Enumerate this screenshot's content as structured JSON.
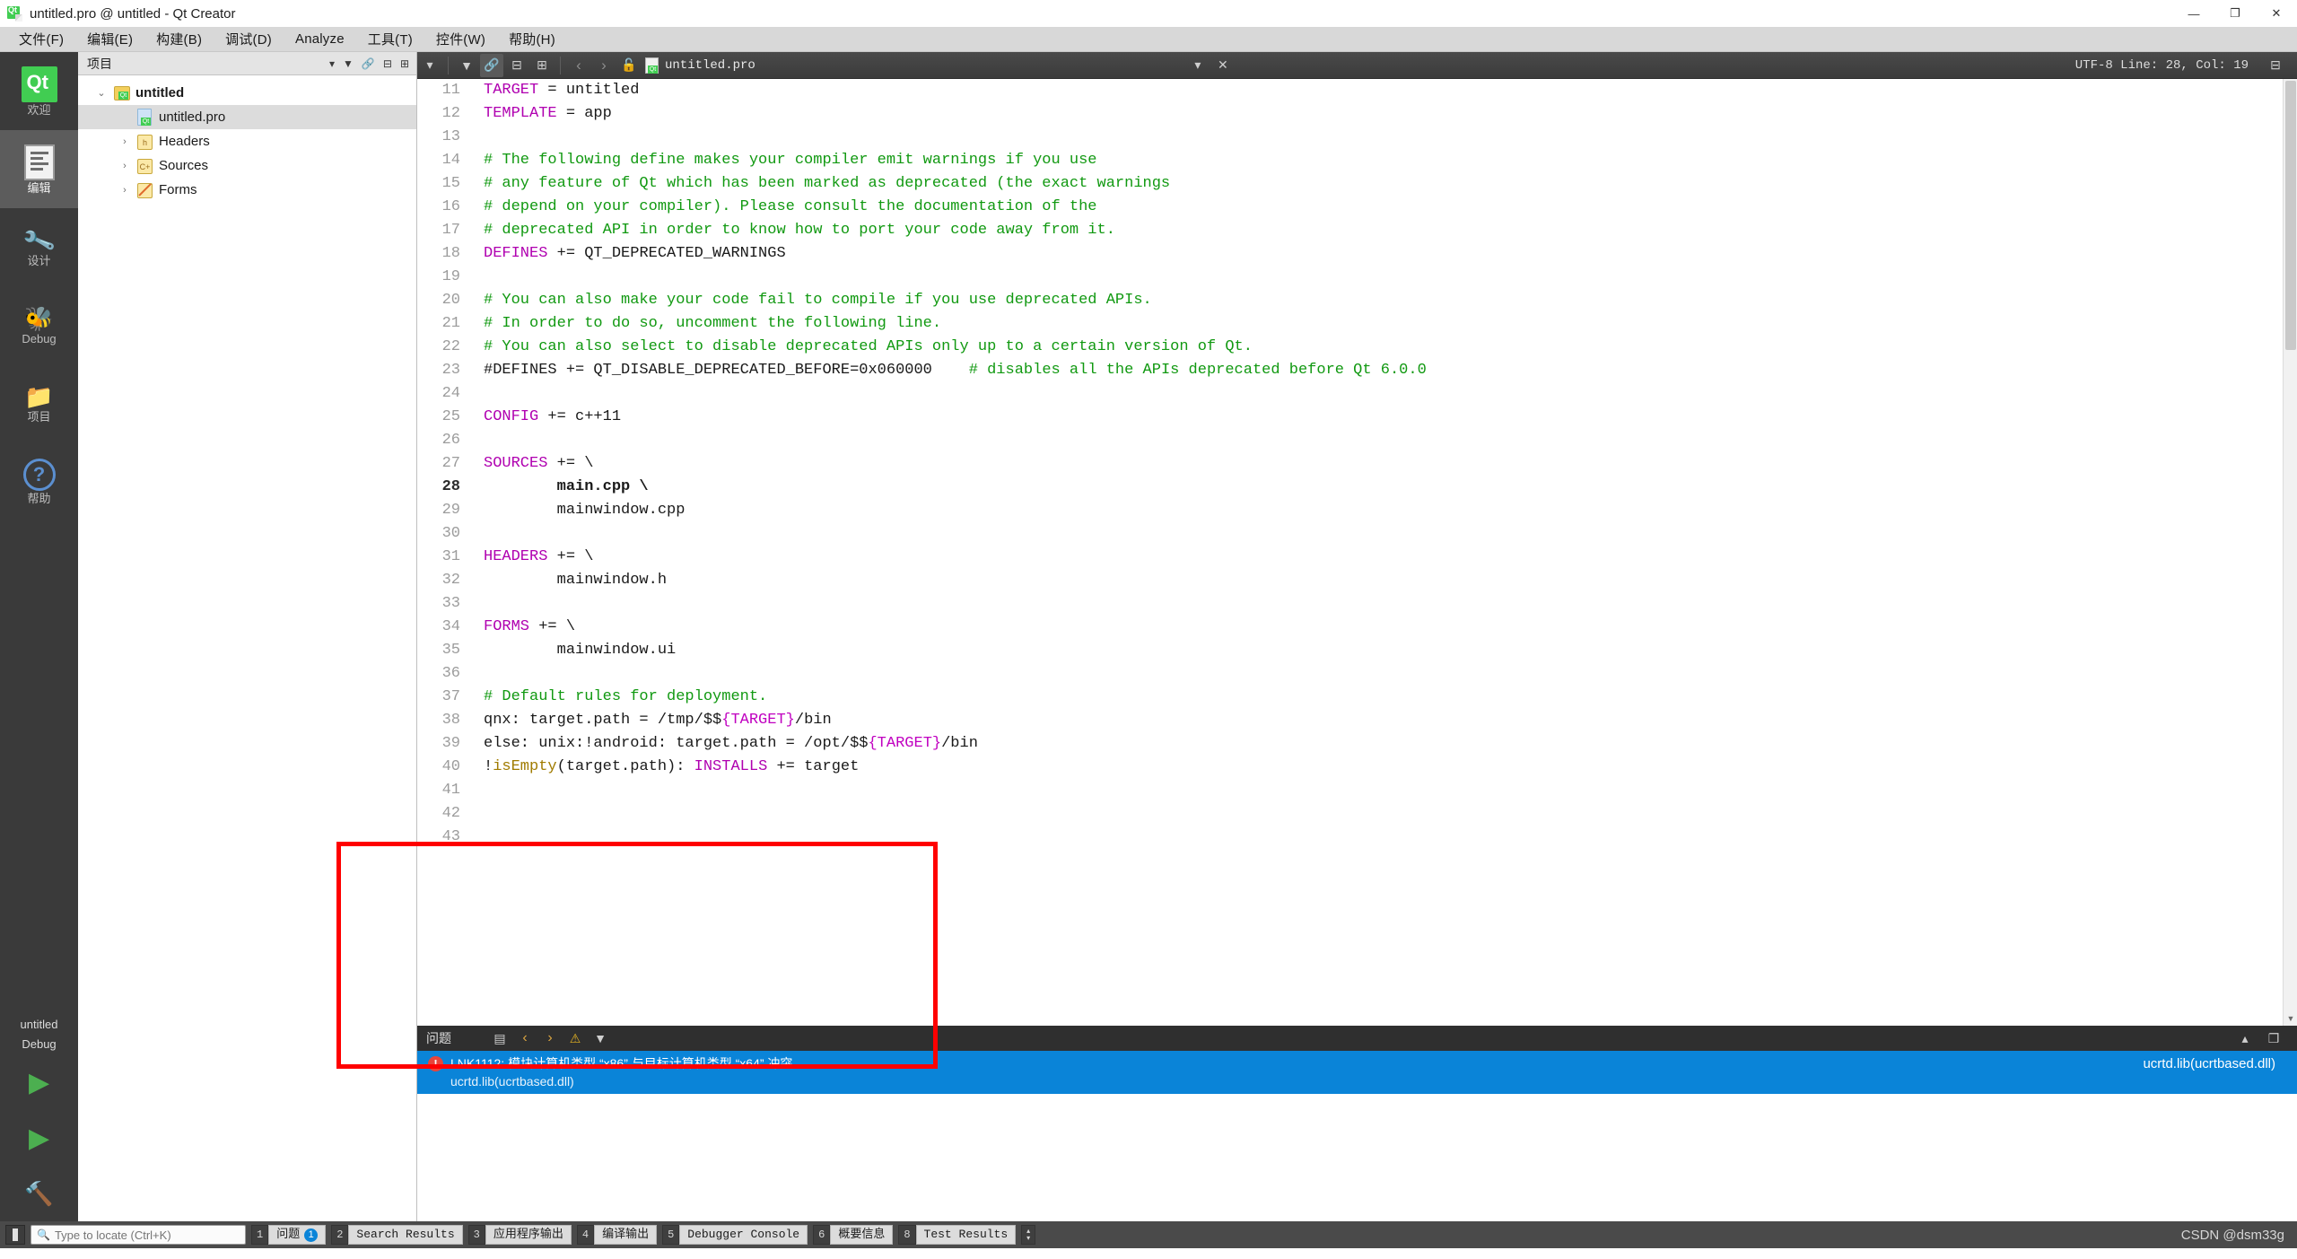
{
  "window": {
    "title": "untitled.pro @ untitled - Qt Creator",
    "minimize": "—",
    "maximize": "❐",
    "close": "✕"
  },
  "menubar": [
    {
      "label": "文件(F)"
    },
    {
      "label": "编辑(E)"
    },
    {
      "label": "构建(B)"
    },
    {
      "label": "调试(D)"
    },
    {
      "label": "Analyze"
    },
    {
      "label": "工具(T)"
    },
    {
      "label": "控件(W)"
    },
    {
      "label": "帮助(H)"
    }
  ],
  "modebar": {
    "items": [
      {
        "label": "欢迎",
        "icon": "qt-logo-icon",
        "selected": false
      },
      {
        "label": "编辑",
        "icon": "document-icon",
        "selected": true
      },
      {
        "label": "设计",
        "icon": "design-wrench-icon",
        "selected": false
      },
      {
        "label": "Debug",
        "icon": "bug-icon",
        "selected": false
      },
      {
        "label": "项目",
        "icon": "project-icon",
        "selected": false
      },
      {
        "label": "帮助",
        "icon": "help-icon",
        "selected": false
      }
    ],
    "kit_name": "untitled",
    "build_config": "Debug",
    "run_label": "run-icon",
    "debug_label": "debug-icon",
    "build_label": "build-icon"
  },
  "project_pane": {
    "header": "项目",
    "tree": [
      {
        "label": "untitled",
        "icon": "qt-project-icon",
        "level": 0,
        "arrow": "⌄",
        "selected": false,
        "bold": true
      },
      {
        "label": "untitled.pro",
        "icon": "pro-file-icon",
        "level": 1,
        "arrow": "",
        "selected": true,
        "bold": false
      },
      {
        "label": "Headers",
        "icon": "headers-folder-icon",
        "level": 1,
        "arrow": "›",
        "selected": false,
        "bold": false
      },
      {
        "label": "Sources",
        "icon": "sources-folder-icon",
        "level": 1,
        "arrow": "›",
        "selected": false,
        "bold": false
      },
      {
        "label": "Forms",
        "icon": "forms-folder-icon",
        "level": 1,
        "arrow": "›",
        "selected": false,
        "bold": false
      }
    ]
  },
  "editor_toolbar": {
    "filter_icon": "filter-icon",
    "link_icon": "link-icon",
    "split_icon": "split-horizontal-icon",
    "close_split_icon": "close-split-icon",
    "back_icon": "‹",
    "forward_icon": "›",
    "lock_icon": "unlocked-icon",
    "tab_name": "untitled.pro",
    "dropdown_icon": "▾",
    "status": "UTF-8 Line: 28, Col: 19",
    "add_split_icon": "add-split-icon",
    "close_icon": "✕"
  },
  "code": {
    "current_line": 28,
    "lines": [
      {
        "n": 11,
        "tokens": [
          {
            "t": "TARGET",
            "c": "k"
          },
          {
            "t": " = untitled",
            "c": "op"
          }
        ]
      },
      {
        "n": 12,
        "tokens": [
          {
            "t": "TEMPLATE",
            "c": "k"
          },
          {
            "t": " = app",
            "c": "op"
          }
        ]
      },
      {
        "n": 13,
        "tokens": []
      },
      {
        "n": 14,
        "tokens": [
          {
            "t": "# The following define makes your compiler emit warnings if you use",
            "c": "cm"
          }
        ]
      },
      {
        "n": 15,
        "tokens": [
          {
            "t": "# any feature of Qt which has been marked as deprecated (the exact warnings",
            "c": "cm"
          }
        ]
      },
      {
        "n": 16,
        "tokens": [
          {
            "t": "# depend on your compiler). Please consult the documentation of the",
            "c": "cm"
          }
        ]
      },
      {
        "n": 17,
        "tokens": [
          {
            "t": "# deprecated API in order to know how to port your code away from it.",
            "c": "cm"
          }
        ]
      },
      {
        "n": 18,
        "tokens": [
          {
            "t": "DEFINES",
            "c": "k"
          },
          {
            "t": " += QT_DEPRECATED_WARNINGS",
            "c": "op"
          }
        ]
      },
      {
        "n": 19,
        "tokens": []
      },
      {
        "n": 20,
        "tokens": [
          {
            "t": "# You can also make your code fail to compile if you use deprecated APIs.",
            "c": "cm"
          }
        ]
      },
      {
        "n": 21,
        "tokens": [
          {
            "t": "# In order to do so, uncomment the following line.",
            "c": "cm"
          }
        ]
      },
      {
        "n": 22,
        "tokens": [
          {
            "t": "# You can also select to disable deprecated APIs only up to a certain version of Qt.",
            "c": "cm"
          }
        ]
      },
      {
        "n": 23,
        "tokens": [
          {
            "t": "#DEFINES += QT_DISABLE_DEPRECATED_BEFORE=0x060000",
            "c": "op"
          },
          {
            "t": "    ",
            "c": "op"
          },
          {
            "t": "# disables all the APIs deprecated before Qt 6.0.0",
            "c": "cm"
          }
        ]
      },
      {
        "n": 24,
        "tokens": []
      },
      {
        "n": 25,
        "tokens": [
          {
            "t": "CONFIG",
            "c": "k"
          },
          {
            "t": " += c++11",
            "c": "op"
          }
        ]
      },
      {
        "n": 26,
        "tokens": []
      },
      {
        "n": 27,
        "tokens": [
          {
            "t": "SOURCES",
            "c": "k"
          },
          {
            "t": " += \\",
            "c": "op"
          }
        ]
      },
      {
        "n": 28,
        "tokens": [
          {
            "t": "        main.cpp \\",
            "c": "op"
          }
        ]
      },
      {
        "n": 29,
        "tokens": [
          {
            "t": "        mainwindow.cpp",
            "c": "op"
          }
        ]
      },
      {
        "n": 30,
        "tokens": []
      },
      {
        "n": 31,
        "tokens": [
          {
            "t": "HEADERS",
            "c": "k"
          },
          {
            "t": " += \\",
            "c": "op"
          }
        ]
      },
      {
        "n": 32,
        "tokens": [
          {
            "t": "        mainwindow.h",
            "c": "op"
          }
        ]
      },
      {
        "n": 33,
        "tokens": []
      },
      {
        "n": 34,
        "tokens": [
          {
            "t": "FORMS",
            "c": "k"
          },
          {
            "t": " += \\",
            "c": "op"
          }
        ]
      },
      {
        "n": 35,
        "tokens": [
          {
            "t": "        mainwindow.ui",
            "c": "op"
          }
        ]
      },
      {
        "n": 36,
        "tokens": []
      },
      {
        "n": 37,
        "tokens": [
          {
            "t": "# Default rules for deployment.",
            "c": "cm"
          }
        ]
      },
      {
        "n": 38,
        "tokens": [
          {
            "t": "qnx: target.path = /tmp/$$",
            "c": "op"
          },
          {
            "t": "{TARGET}",
            "c": "v"
          },
          {
            "t": "/bin",
            "c": "op"
          }
        ]
      },
      {
        "n": 39,
        "tokens": [
          {
            "t": "else: unix:!android: target.path = /opt/$$",
            "c": "op"
          },
          {
            "t": "{TARGET}",
            "c": "v"
          },
          {
            "t": "/bin",
            "c": "op"
          }
        ]
      },
      {
        "n": 40,
        "tokens": [
          {
            "t": "!",
            "c": "op"
          },
          {
            "t": "isEmpty",
            "c": "fn"
          },
          {
            "t": "(target.path): ",
            "c": "op"
          },
          {
            "t": "INSTALLS",
            "c": "k"
          },
          {
            "t": " += target",
            "c": "op"
          }
        ]
      },
      {
        "n": 41,
        "tokens": []
      },
      {
        "n": 42,
        "tokens": []
      },
      {
        "n": 43,
        "tokens": []
      }
    ]
  },
  "issues": {
    "title": "问题",
    "toolbar_icons": [
      "filter-categorize-icon",
      "prev-issue-icon",
      "next-issue-icon",
      "warning-filter-icon",
      "filter-dropdown-icon"
    ],
    "panel_min_icon": "▴",
    "panel_max_icon": "❐",
    "rows": [
      {
        "severity": "error",
        "severity_glyph": "!",
        "message": "LNK1112: 模块计算机类型 “x86” 与目标计算机类型 “x64” 冲突",
        "detail": "ucrtd.lib(ucrtbased.dll)",
        "file": "ucrtd.lib(ucrtbased.dll)"
      }
    ]
  },
  "annotation": {
    "box_color": "#ff0000"
  },
  "statusbar": {
    "toggle_icon": "sidebar-toggle-icon",
    "search": {
      "placeholder": "Type to locate (Ctrl+K)",
      "value": "",
      "icon": "search-icon"
    },
    "items": [
      {
        "num": "1",
        "label": "问题",
        "badge": "1"
      },
      {
        "num": "2",
        "label": "Search Results",
        "badge": ""
      },
      {
        "num": "3",
        "label": "应用程序输出",
        "badge": ""
      },
      {
        "num": "4",
        "label": "编译输出",
        "badge": ""
      },
      {
        "num": "5",
        "label": "Debugger Console",
        "badge": ""
      },
      {
        "num": "6",
        "label": "概要信息",
        "badge": ""
      },
      {
        "num": "8",
        "label": "Test Results",
        "badge": ""
      }
    ],
    "spinner_up": "▴",
    "spinner_down": "▾",
    "watermark": "CSDN @dsm33g"
  }
}
